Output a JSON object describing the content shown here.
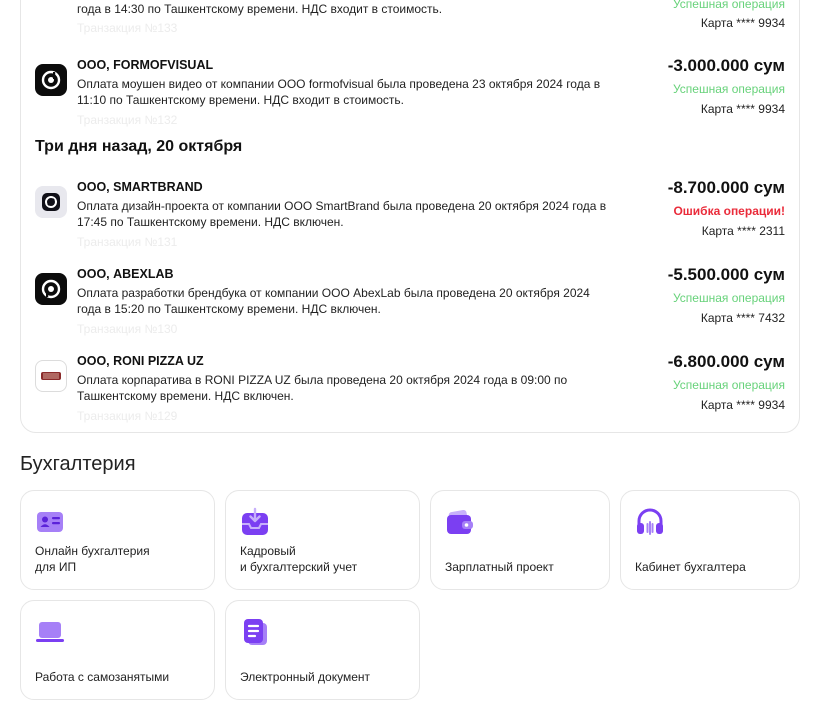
{
  "transactions_card": {
    "top_fragment": {
      "desc": "года в 14:30 по Ташкентскому времени. НДС входит в стоимость.",
      "txn": "Транзакция №133",
      "status": "Успешная операция",
      "card": "Карта **** 9934"
    },
    "items": [
      {
        "name": "ООО, FORMOFVISUAL",
        "desc": "Оплата моушен видео от компании ООО formofvisual была проведена 23 октября 2024 года в 11:10 по Ташкентскому времени. НДС входит в стоимость.",
        "txn": "Транзакция №132",
        "amount": "-3.000.000 сум",
        "status": "Успешная операция",
        "card": "Карта **** 9934"
      },
      {
        "name": "ООО, SMARTBRAND",
        "desc": "Оплата дизайн-проекта от компании ООО SmartBrand была проведена 20 октября 2024 года в 17:45 по Ташкентскому времени. НДС включен.",
        "txn": "Транзакция №131",
        "amount": "-8.700.000 сум",
        "status": "Ошибка операции!",
        "card": "Карта **** 2311"
      },
      {
        "name": "ООО, ABEXLAB",
        "desc": "Оплата разработки брендбука от компании ООО AbexLab была проведена 20 октября 2024 года в 15:20 по Ташкентскому времени. НДС включен.",
        "txn": "Транзакция №130",
        "amount": "-5.500.000 сум",
        "status": "Успешная операция",
        "card": "Карта **** 7432"
      },
      {
        "name": "ООО, RONI PIZZA UZ",
        "desc": "Оплата корпаратива в RONI PIZZA UZ была проведена 20 октября 2024 года в 09:00 по Ташкентскому времени. НДС включен.",
        "txn": "Транзакция №129",
        "amount": "-6.800.000 сум",
        "status": "Успешная операция",
        "card": "Карта **** 9934"
      }
    ],
    "date_heading": "Три дня назад, 20 октября"
  },
  "accounting": {
    "title": "Бухгалтерия",
    "tiles": [
      {
        "label": "Онлайн бухгалтерия\nдля ИП",
        "icon": "id-card-icon"
      },
      {
        "label": "Кадровый\nи бухгалтерский учет",
        "icon": "tray-download-icon"
      },
      {
        "label": "Зарплатный проект",
        "icon": "wallet-icon"
      },
      {
        "label": "Кабинет бухгалтера",
        "icon": "headset-icon"
      },
      {
        "label": "Работа с самозанятыми",
        "icon": "laptop-icon"
      },
      {
        "label": "Электронный документ",
        "icon": "document-icon"
      }
    ]
  },
  "colors": {
    "accent": "#7b3ff2",
    "accent_light": "#a680f7",
    "success": "#67d27a",
    "error": "#ea2b3a"
  }
}
